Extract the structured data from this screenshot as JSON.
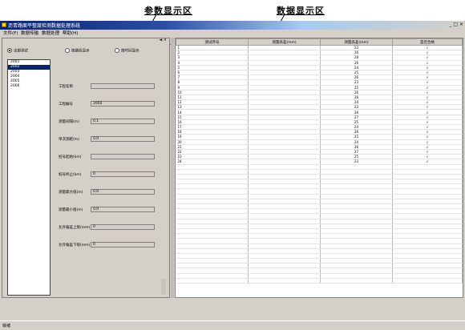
{
  "callouts": {
    "left": "参数显示区",
    "right": "数据显示区"
  },
  "window": {
    "title": "沥青路面平整度检测数据处理系统",
    "buttons": "_ □ ×"
  },
  "menu": [
    "文件(F)",
    "数据传输",
    "数据处理",
    "帮助(H)"
  ],
  "toolbar_icons": [
    "open-icon",
    "save-icon",
    "print-icon",
    "preview-icon",
    "copy-icon",
    "table-icon",
    "chart-icon",
    "report-icon",
    "excel-icon",
    "export-icon",
    "calc-icon",
    "page-icon",
    "line-icon",
    "curve-icon",
    "grid-icon",
    "help-icon"
  ],
  "left_panel": {
    "close": "◄ ×",
    "radios": [
      {
        "label": "全部测试",
        "selected": true
      },
      {
        "label": "按路段显示",
        "selected": false
      },
      {
        "label": "按时间显示",
        "selected": false
      }
    ],
    "list": [
      {
        "label": "2001",
        "selected": false
      },
      {
        "label": "2002",
        "selected": true
      },
      {
        "label": "2003",
        "selected": false
      },
      {
        "label": "2004",
        "selected": false
      },
      {
        "label": "2005",
        "selected": false
      },
      {
        "label": "2006",
        "selected": false
      }
    ],
    "fields": [
      {
        "label": "工程名称",
        "value": ""
      },
      {
        "label": "工程编号",
        "value": "2002"
      },
      {
        "label": "测量间隔(m)",
        "value": "0.1"
      },
      {
        "label": "单次测距(m)",
        "value": "0.0"
      },
      {
        "label": "桩号起始(km)",
        "value": ""
      },
      {
        "label": "桩号终止(km)",
        "value": "0"
      },
      {
        "label": "测量最大值(m)",
        "value": "0.0"
      },
      {
        "label": "测量最小值(m)",
        "value": "0.0"
      },
      {
        "label": "允许偏差上限(mm)",
        "value": "0"
      },
      {
        "label": "允许偏差下限(mm)",
        "value": "0"
      }
    ]
  },
  "grid": {
    "headers": [
      "测试序号",
      "测量高差(mm)",
      "测量高差(mm)",
      "是否合格"
    ],
    "rows": [
      [
        "1",
        "",
        "23",
        "√"
      ],
      [
        "2",
        "",
        "26",
        "√"
      ],
      [
        "3",
        "",
        "28",
        "√"
      ],
      [
        "4",
        "",
        "26",
        "√"
      ],
      [
        "5",
        "",
        "24",
        "√"
      ],
      [
        "6",
        "",
        "25",
        "√"
      ],
      [
        "7",
        "",
        "26",
        "√"
      ],
      [
        "8",
        "",
        "23",
        "√"
      ],
      [
        "9",
        "",
        "25",
        "√"
      ],
      [
        "10",
        "",
        "26",
        "√"
      ],
      [
        "11",
        "",
        "26",
        "√"
      ],
      [
        "12",
        "",
        "24",
        "√"
      ],
      [
        "13",
        "",
        "23",
        "√"
      ],
      [
        "14",
        "",
        "26",
        "√"
      ],
      [
        "15",
        "",
        "27",
        "√"
      ],
      [
        "16",
        "",
        "25",
        "√"
      ],
      [
        "17",
        "",
        "24",
        "√"
      ],
      [
        "18",
        "",
        "26",
        "√"
      ],
      [
        "19",
        "",
        "25",
        "√"
      ],
      [
        "20",
        "",
        "24",
        "√"
      ],
      [
        "21",
        "",
        "26",
        "√"
      ],
      [
        "22",
        "",
        "27",
        "√"
      ],
      [
        "23",
        "",
        "25",
        "√"
      ],
      [
        "24",
        "",
        "23",
        "√"
      ]
    ],
    "empty_rows": 24
  },
  "status": "就绪"
}
